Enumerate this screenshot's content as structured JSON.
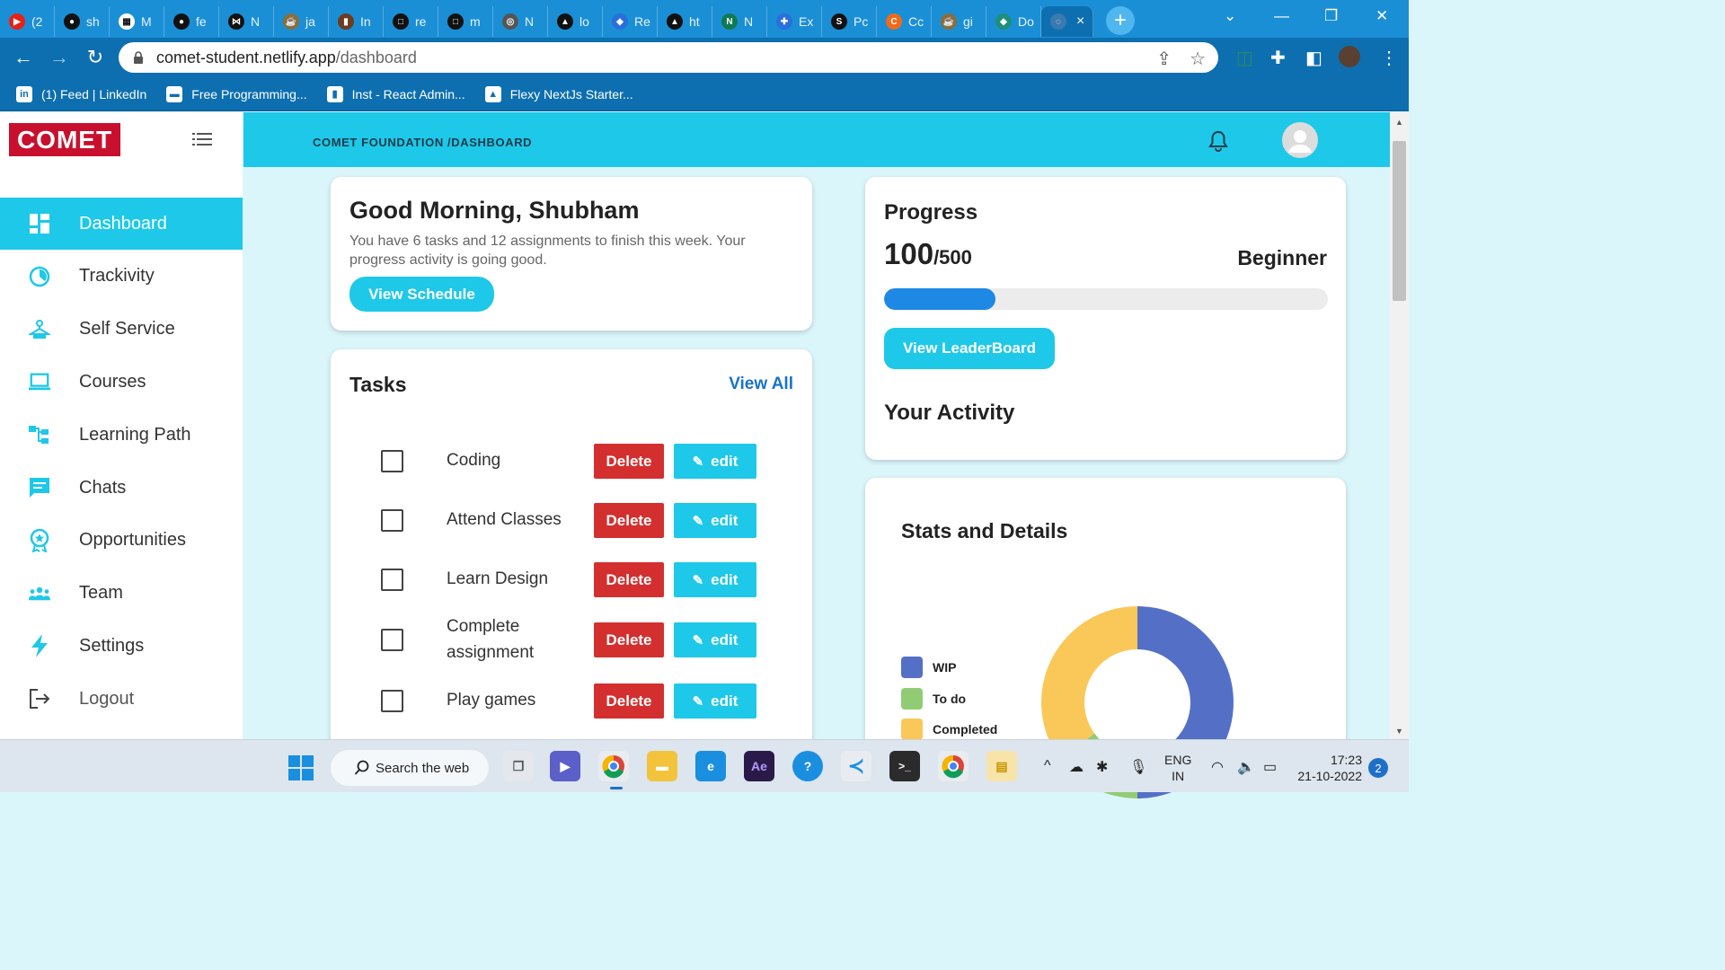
{
  "browser": {
    "tabs": [
      {
        "label": "(2",
        "icon": "youtube-icon",
        "color": "#e62117",
        "glyph": "▶"
      },
      {
        "label": "sh",
        "icon": "github-icon",
        "color": "#111111",
        "glyph": "●"
      },
      {
        "label": "M",
        "icon": "figma-icon",
        "color": "#ffffff",
        "glyph": "▦"
      },
      {
        "label": "fe",
        "icon": "github-icon",
        "color": "#111111",
        "glyph": "●"
      },
      {
        "label": "N",
        "icon": "bow-icon",
        "color": "#111111",
        "glyph": "⋈"
      },
      {
        "label": "ja",
        "icon": "java-icon",
        "color": "#8a6d3b",
        "glyph": "☕"
      },
      {
        "label": "In",
        "icon": "book-icon",
        "color": "#6d3b1f",
        "glyph": "▮"
      },
      {
        "label": "re",
        "icon": "square-icon",
        "color": "#111111",
        "glyph": "□"
      },
      {
        "label": "m",
        "icon": "square-icon",
        "color": "#111111",
        "glyph": "□"
      },
      {
        "label": "N",
        "icon": "chrome-icon",
        "color": "#555555",
        "glyph": "◎"
      },
      {
        "label": "lo",
        "icon": "vercel-icon",
        "color": "#111111",
        "glyph": "▲"
      },
      {
        "label": "Re",
        "icon": "dropbox-icon",
        "color": "#2a6fdb",
        "glyph": "◆"
      },
      {
        "label": "ht",
        "icon": "vercel-icon",
        "color": "#111111",
        "glyph": "▲"
      },
      {
        "label": "N",
        "icon": "notion-icon",
        "color": "#0f7a52",
        "glyph": "N"
      },
      {
        "label": "Ex",
        "icon": "puzzle-icon",
        "color": "#2a6fdb",
        "glyph": "✚"
      },
      {
        "label": "Pc",
        "icon": "letter-s-icon",
        "color": "#111111",
        "glyph": "S"
      },
      {
        "label": "Cc",
        "icon": "letter-c-icon",
        "color": "#f06a1b",
        "glyph": "C"
      },
      {
        "label": "gi",
        "icon": "java-icon",
        "color": "#8a6d3b",
        "glyph": "☕"
      },
      {
        "label": "Do",
        "icon": "diamond-icon",
        "color": "#1f8f7a",
        "glyph": "◆"
      }
    ],
    "active_tab_close": "×",
    "new_tab": "+",
    "url_host": "comet-student.netlify.app",
    "url_path": "/dashboard",
    "bookmarks": [
      {
        "label": "(1) Feed | LinkedIn",
        "icon": "linkedin-icon",
        "glyph": "in"
      },
      {
        "label": "Free Programming...",
        "icon": "bookmark-site-icon",
        "glyph": "▬"
      },
      {
        "label": "Inst - React Admin...",
        "icon": "bookmark-site-icon",
        "glyph": "▮"
      },
      {
        "label": "Flexy NextJs Starter...",
        "icon": "vercel-icon",
        "glyph": "▲"
      }
    ]
  },
  "app": {
    "logo": "COMET",
    "breadcrumb": "COMET FOUNDATION /DASHBOARD",
    "nav": [
      {
        "label": "Dashboard",
        "icon": "dashboard-icon",
        "active": true
      },
      {
        "label": "Trackivity",
        "icon": "trackivity-icon",
        "active": false
      },
      {
        "label": "Self Service",
        "icon": "hanger-icon",
        "active": false
      },
      {
        "label": "Courses",
        "icon": "laptop-icon",
        "active": false
      },
      {
        "label": "Learning Path",
        "icon": "hierarchy-icon",
        "active": false
      },
      {
        "label": "Chats",
        "icon": "chat-icon",
        "active": false
      },
      {
        "label": "Opportunities",
        "icon": "award-icon",
        "active": false
      },
      {
        "label": "Team",
        "icon": "team-icon",
        "active": false
      },
      {
        "label": "Settings",
        "icon": "bolt-icon",
        "active": false
      },
      {
        "label": "Logout",
        "icon": "logout-icon",
        "active": false
      }
    ],
    "greeting": {
      "title": "Good Morning, Shubham",
      "subtitle": "You have 6 tasks and 12 assignments to finish this week. Your progress activity is going good.",
      "button": "View Schedule"
    },
    "tasks": {
      "title": "Tasks",
      "view_all": "View All",
      "delete_label": "Delete",
      "edit_label": "edit",
      "items": [
        {
          "name": "Coding",
          "checked": false
        },
        {
          "name": "Attend Classes",
          "checked": false
        },
        {
          "name": "Learn Design",
          "checked": false
        },
        {
          "name": "Complete assignment",
          "checked": false
        },
        {
          "name": "Play games",
          "checked": false
        }
      ]
    },
    "progress": {
      "title": "Progress",
      "current": "100",
      "total": "/500",
      "level": "Beginner",
      "fraction": 0.25,
      "button": "View LeaderBoard",
      "activity_title": "Your Activity"
    },
    "stats": {
      "title": "Stats and Details",
      "legend": [
        {
          "label": "WIP",
          "color": "#5470c6"
        },
        {
          "label": "To do",
          "color": "#91cc75"
        },
        {
          "label": "Completed",
          "color": "#fac858"
        }
      ],
      "values": [
        50,
        15,
        35
      ]
    }
  },
  "taskbar": {
    "search": "Search the web",
    "lang_top": "ENG",
    "lang_bottom": "IN",
    "time": "17:23",
    "date": "21-10-2022",
    "notifications": "2"
  },
  "colors": {
    "accent": "#1ec8e8",
    "danger": "#d32f2f",
    "brand": "#c8102e",
    "progress": "#1e88e5"
  }
}
